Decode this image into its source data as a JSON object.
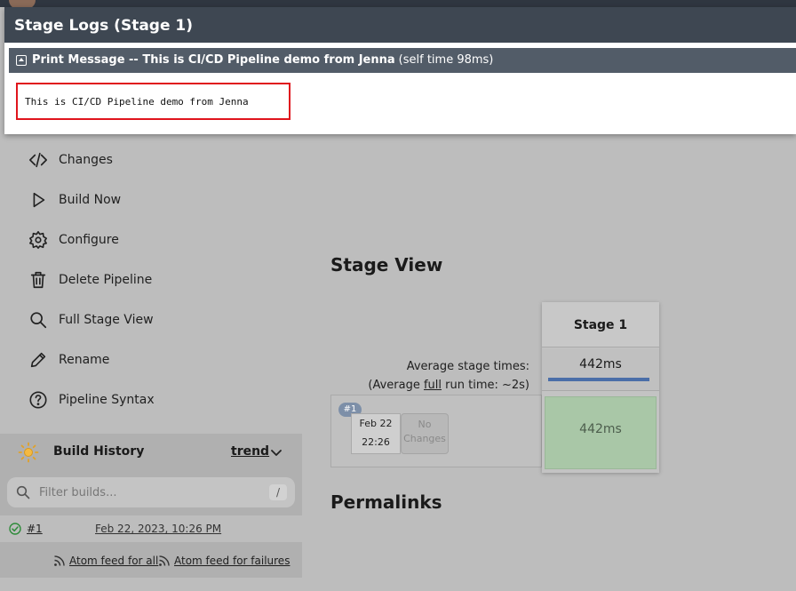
{
  "modal": {
    "title": "Stage Logs (Stage 1)",
    "step_label": "Print Message -- This is CI/CD Pipeline demo from Jenna",
    "self_time": "(self time 98ms)",
    "log_output": "This is CI/CD Pipeline demo from Jenna",
    "highlight_color": "#e0151d"
  },
  "sidebar": {
    "items": [
      {
        "label": "Changes",
        "icon": "code-icon"
      },
      {
        "label": "Build Now",
        "icon": "play-icon"
      },
      {
        "label": "Configure",
        "icon": "gear-icon"
      },
      {
        "label": "Delete Pipeline",
        "icon": "trash-icon"
      },
      {
        "label": "Full Stage View",
        "icon": "search-icon"
      },
      {
        "label": "Rename",
        "icon": "pencil-icon"
      },
      {
        "label": "Pipeline Syntax",
        "icon": "help-icon"
      }
    ]
  },
  "build_history": {
    "title": "Build History",
    "trend_label": "trend",
    "filter_placeholder": "Filter builds...",
    "filter_shortcut": "/",
    "builds": [
      {
        "number": "#1",
        "date": "Feb 22, 2023, 10:26 PM",
        "status": "success"
      }
    ],
    "feed_all": "Atom feed for all",
    "feed_failures": "Atom feed for failures"
  },
  "stage_view": {
    "heading": "Stage View",
    "avg_stage_times": "Average stage times:",
    "avg_run_prefix": "(Average ",
    "avg_run_full": "full",
    "avg_run_suffix": " run time: ~2s)",
    "run": {
      "badge": "#1",
      "date": "Feb 22",
      "time": "22:26",
      "changes": "No Changes"
    },
    "stages": [
      {
        "name": "Stage 1",
        "avg_time": "442ms",
        "run_time": "442ms",
        "status_color": "#a9c7a7"
      }
    ]
  },
  "permalinks_heading": "Permalinks"
}
